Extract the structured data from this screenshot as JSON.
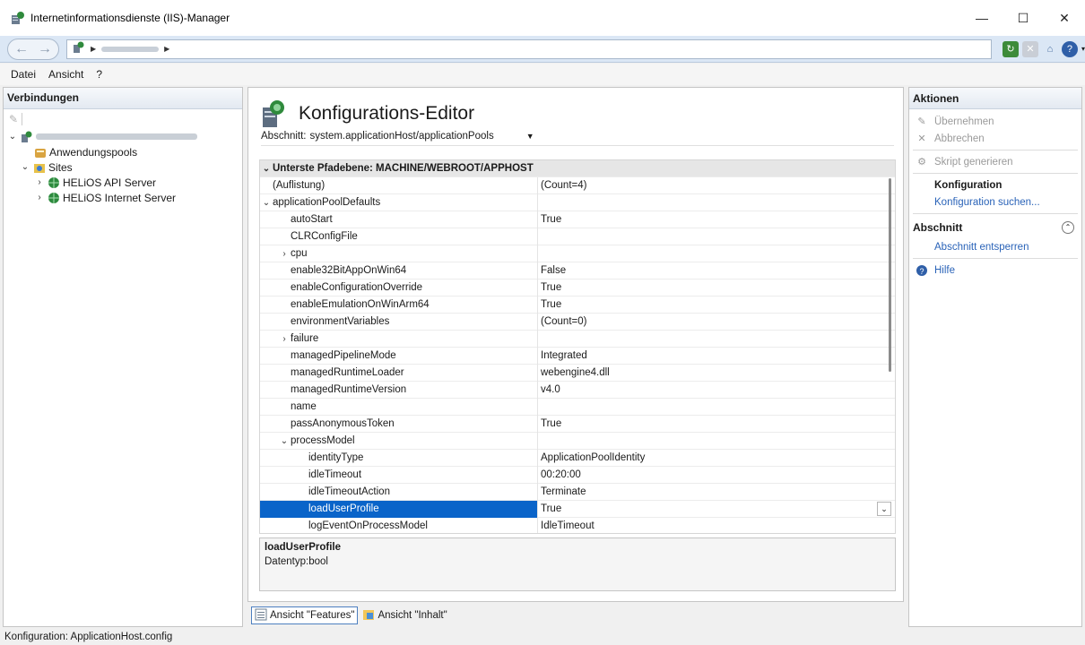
{
  "window": {
    "title": "Internetinformationsdienste (IIS)-Manager"
  },
  "menu": [
    "Datei",
    "Ansicht",
    "?"
  ],
  "connections": {
    "title": "Verbindungen",
    "tree": [
      {
        "label": "Anwendungspools",
        "level": 2
      },
      {
        "label": "Sites",
        "level": 1
      },
      {
        "label": "HELiOS API Server",
        "level": 2
      },
      {
        "label": "HELiOS Internet Server",
        "level": 2
      }
    ]
  },
  "editor": {
    "title": "Konfigurations-Editor",
    "section_label": "Abschnitt:",
    "section_value": "system.applicationHost/applicationPools",
    "header": "Unterste Pfadebene: MACHINE/WEBROOT/APPHOST",
    "rows": [
      {
        "name": "(Auflistung)",
        "value": "(Count=4)",
        "indent": 0,
        "exp": ""
      },
      {
        "name": "applicationPoolDefaults",
        "value": "",
        "indent": 0,
        "exp": "v"
      },
      {
        "name": "autoStart",
        "value": "True",
        "indent": 1,
        "exp": ""
      },
      {
        "name": "CLRConfigFile",
        "value": "",
        "indent": 1,
        "exp": ""
      },
      {
        "name": "cpu",
        "value": "",
        "indent": 1,
        "exp": ">"
      },
      {
        "name": "enable32BitAppOnWin64",
        "value": "False",
        "indent": 1,
        "exp": ""
      },
      {
        "name": "enableConfigurationOverride",
        "value": "True",
        "indent": 1,
        "exp": ""
      },
      {
        "name": "enableEmulationOnWinArm64",
        "value": "True",
        "indent": 1,
        "exp": ""
      },
      {
        "name": "environmentVariables",
        "value": "(Count=0)",
        "indent": 1,
        "exp": ""
      },
      {
        "name": "failure",
        "value": "",
        "indent": 1,
        "exp": ">"
      },
      {
        "name": "managedPipelineMode",
        "value": "Integrated",
        "indent": 1,
        "exp": ""
      },
      {
        "name": "managedRuntimeLoader",
        "value": "webengine4.dll",
        "indent": 1,
        "exp": ""
      },
      {
        "name": "managedRuntimeVersion",
        "value": "v4.0",
        "indent": 1,
        "exp": ""
      },
      {
        "name": "name",
        "value": "",
        "indent": 1,
        "exp": ""
      },
      {
        "name": "passAnonymousToken",
        "value": "True",
        "indent": 1,
        "exp": ""
      },
      {
        "name": "processModel",
        "value": "",
        "indent": 1,
        "exp": "v"
      },
      {
        "name": "identityType",
        "value": "ApplicationPoolIdentity",
        "indent": 2,
        "exp": ""
      },
      {
        "name": "idleTimeout",
        "value": "00:20:00",
        "indent": 2,
        "exp": ""
      },
      {
        "name": "idleTimeoutAction",
        "value": "Terminate",
        "indent": 2,
        "exp": ""
      },
      {
        "name": "loadUserProfile",
        "value": "True",
        "indent": 2,
        "exp": "",
        "selected": true
      },
      {
        "name": "logEventOnProcessModel",
        "value": "IdleTimeout",
        "indent": 2,
        "exp": ""
      }
    ],
    "description": {
      "name": "loadUserProfile",
      "type": "Datentyp:bool"
    },
    "tabs": [
      {
        "label": "Ansicht \"Features\"",
        "active": true
      },
      {
        "label": "Ansicht \"Inhalt\"",
        "active": false
      }
    ]
  },
  "actions": {
    "title": "Aktionen",
    "items": [
      {
        "label": "Übernehmen",
        "style": "disabled",
        "icon": "apply-icon"
      },
      {
        "label": "Abbrechen",
        "style": "disabled",
        "icon": "cancel-icon"
      },
      {
        "label": "Skript generieren",
        "style": "disabled",
        "icon": "script-icon"
      },
      {
        "label": "Konfiguration",
        "style": "bold",
        "icon": ""
      },
      {
        "label": "Konfiguration suchen...",
        "style": "link",
        "icon": ""
      }
    ],
    "section_title": "Abschnitt",
    "section_items": [
      {
        "label": "Abschnitt entsperren",
        "style": "link",
        "icon": ""
      }
    ],
    "help": "Hilfe"
  },
  "status": {
    "text": "Konfiguration: ApplicationHost.config"
  }
}
